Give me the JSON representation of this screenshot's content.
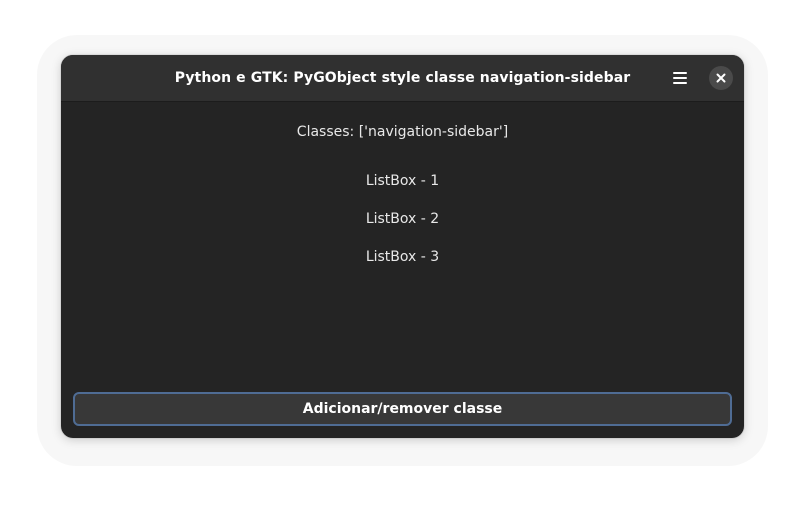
{
  "window": {
    "title": "Python e GTK: PyGObject style classe navigation-sidebar",
    "menu_icon": "hamburger-menu-icon",
    "close_icon": "close-icon"
  },
  "content": {
    "classes_label": "Classes: ['navigation-sidebar']",
    "list_items": [
      {
        "label": "ListBox - 1"
      },
      {
        "label": "ListBox - 2"
      },
      {
        "label": "ListBox - 3"
      }
    ],
    "toggle_button_label": "Adicionar/remover classe"
  },
  "colors": {
    "window_background": "#242424",
    "headerbar_background": "#303030",
    "button_background": "#383838",
    "focus_accent": "#4f6c94"
  }
}
